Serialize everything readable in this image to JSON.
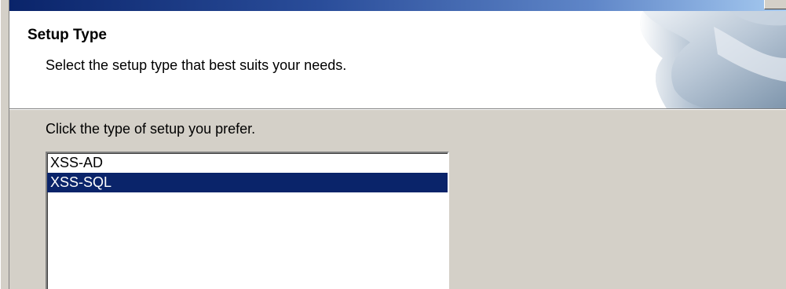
{
  "header": {
    "title": "Setup Type",
    "subtitle": "Select the setup type that best suits your needs."
  },
  "main": {
    "prompt": "Click the type of setup you prefer.",
    "setup_types": [
      {
        "label": "XSS-AD",
        "selected": false
      },
      {
        "label": "XSS-SQL",
        "selected": true
      }
    ]
  },
  "colors": {
    "selection": "#0a246a",
    "titlebar": "#0a246a",
    "dialog_bg": "#d4d0c8"
  }
}
